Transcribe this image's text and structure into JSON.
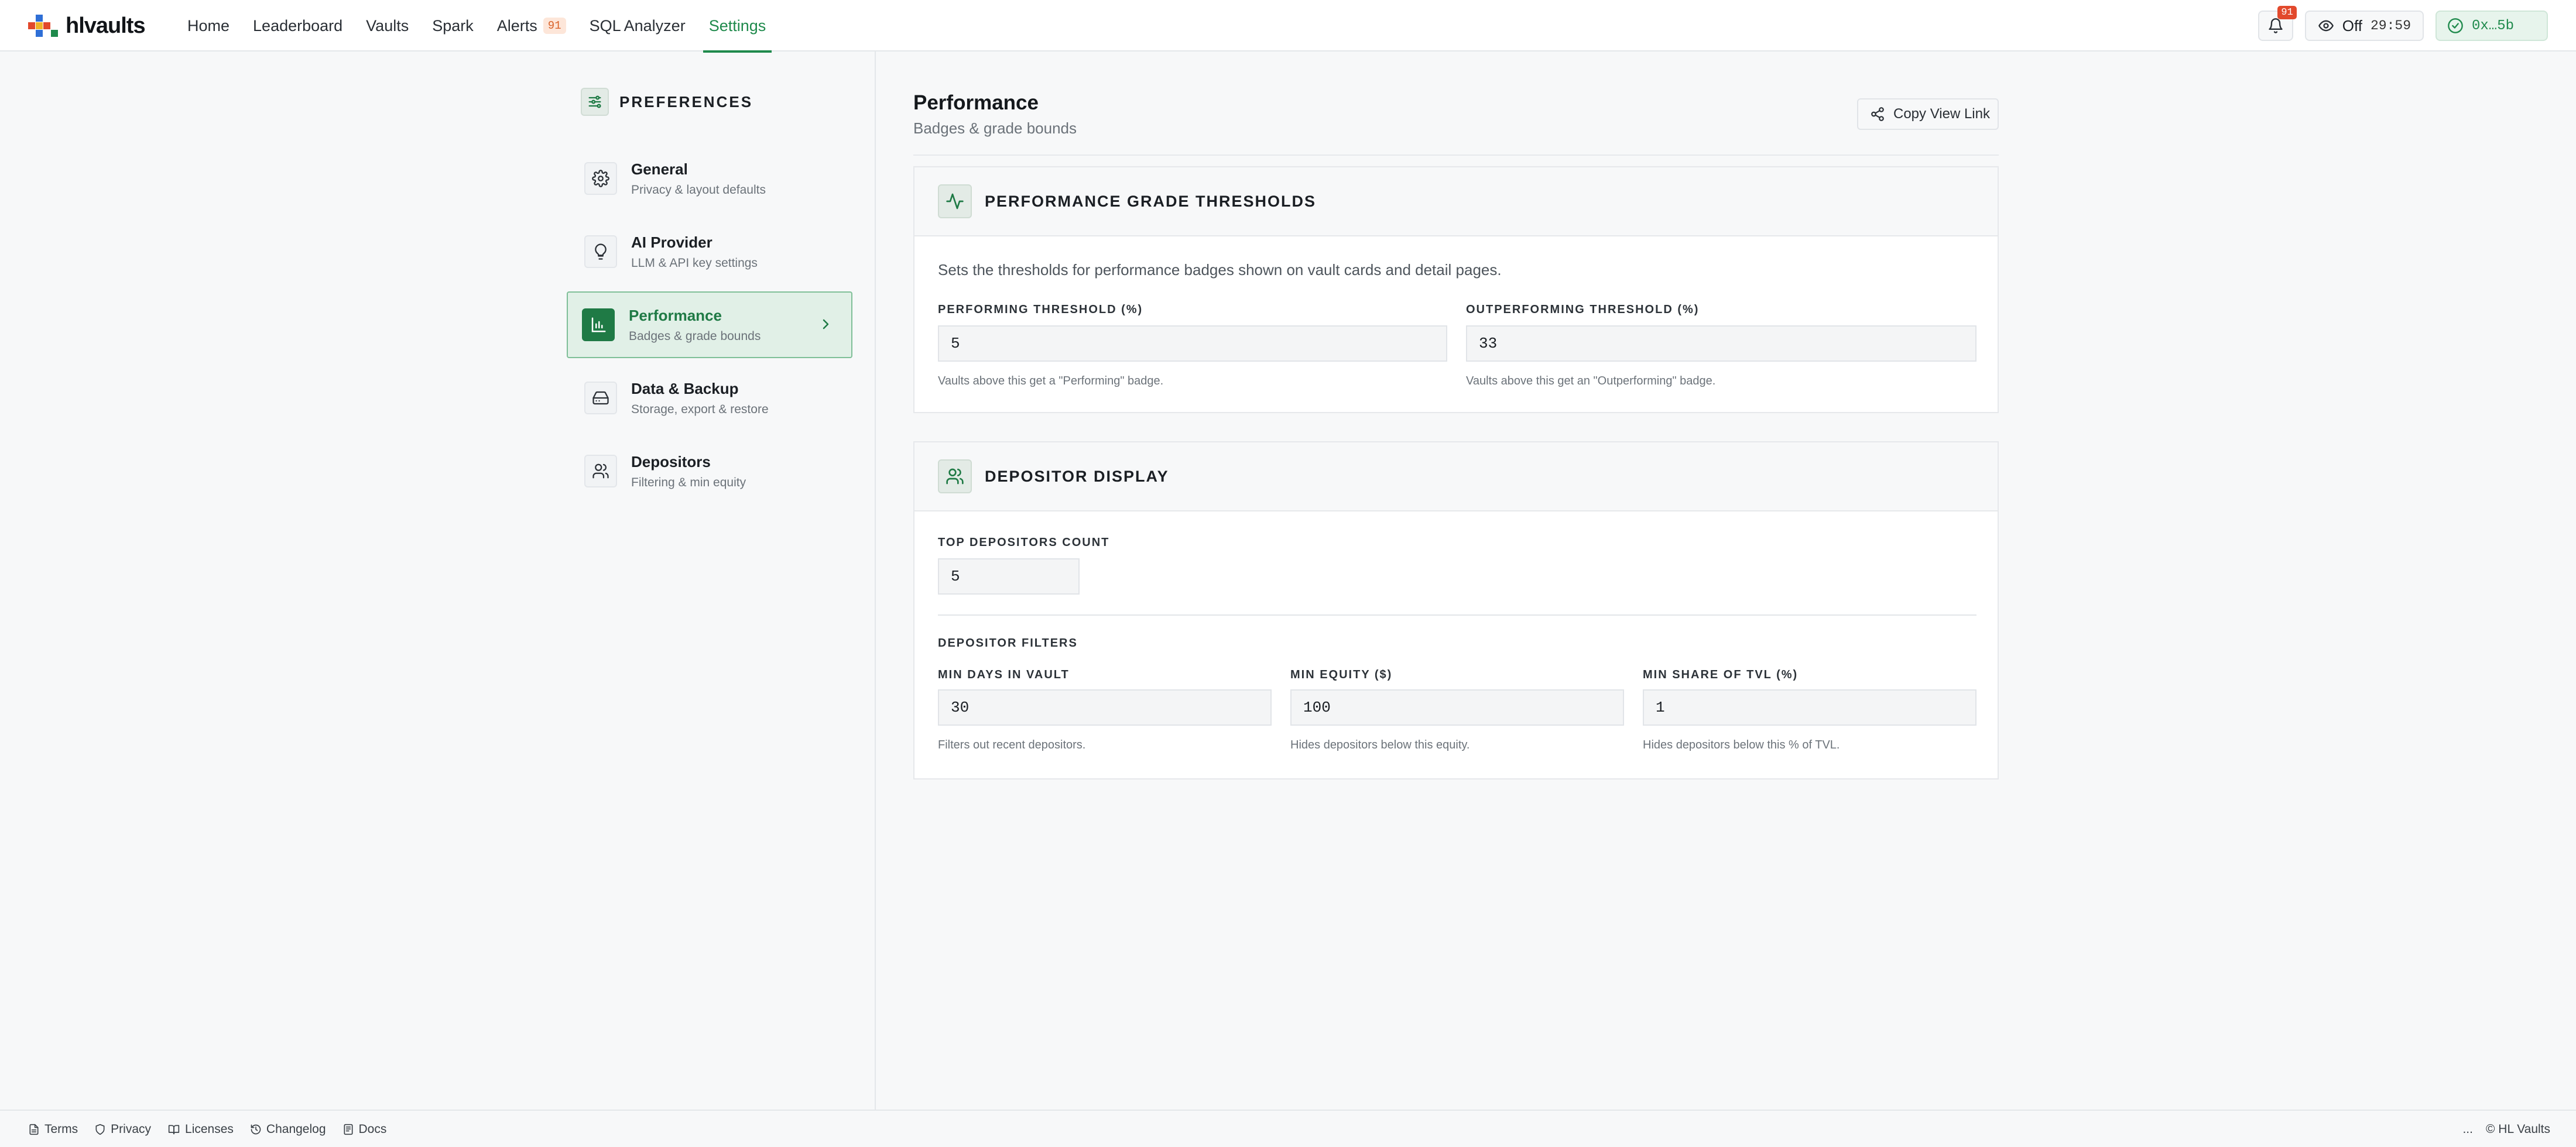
{
  "app": {
    "logo_text": "hlvaults"
  },
  "nav": {
    "items": [
      {
        "label": "Home"
      },
      {
        "label": "Leaderboard"
      },
      {
        "label": "Vaults"
      },
      {
        "label": "Spark"
      },
      {
        "label": "Alerts",
        "badge": "91"
      },
      {
        "label": "SQL Analyzer"
      },
      {
        "label": "Settings",
        "active": true
      }
    ]
  },
  "topbar": {
    "notifications_badge": "91",
    "privacy_label": "Off",
    "privacy_timer": "29:59",
    "wallet_label": "0x…5b"
  },
  "sidebar": {
    "title": "PREFERENCES",
    "items": [
      {
        "label": "General",
        "desc": "Privacy & layout defaults",
        "icon": "gear-icon"
      },
      {
        "label": "AI Provider",
        "desc": "LLM & API key settings",
        "icon": "lightbulb-icon"
      },
      {
        "label": "Performance",
        "desc": "Badges & grade bounds",
        "icon": "bar-chart-icon",
        "active": true
      },
      {
        "label": "Data & Backup",
        "desc": "Storage, export & restore",
        "icon": "hard-drive-icon"
      },
      {
        "label": "Depositors",
        "desc": "Filtering & min equity",
        "icon": "users-icon"
      }
    ]
  },
  "main": {
    "title": "Performance",
    "subtitle": "Badges & grade bounds",
    "copy_link_label": "Copy View Link",
    "grade_card": {
      "title": "PERFORMANCE GRADE THRESHOLDS",
      "description": "Sets the thresholds for performance badges shown on vault cards and detail pages.",
      "performing": {
        "label": "PERFORMING THRESHOLD (%)",
        "value": "5",
        "help": "Vaults above this get a \"Performing\" badge."
      },
      "outperforming": {
        "label": "OUTPERFORMING THRESHOLD (%)",
        "value": "33",
        "help": "Vaults above this get an \"Outperforming\" badge."
      }
    },
    "depositor_card": {
      "title": "DEPOSITOR DISPLAY",
      "top_count": {
        "label": "TOP DEPOSITORS COUNT",
        "value": "5"
      },
      "filters_title": "DEPOSITOR FILTERS",
      "min_days": {
        "label": "MIN DAYS IN VAULT",
        "value": "30",
        "help": "Filters out recent depositors."
      },
      "min_equity": {
        "label": "MIN EQUITY ($)",
        "value": "100",
        "help": "Hides depositors below this equity."
      },
      "min_share": {
        "label": "MIN SHARE OF TVL (%)",
        "value": "1",
        "help": "Hides depositors below this % of TVL."
      }
    }
  },
  "footer": {
    "links": [
      {
        "label": "Terms",
        "icon": "file-icon"
      },
      {
        "label": "Privacy",
        "icon": "shield-icon"
      },
      {
        "label": "Licenses",
        "icon": "book-icon"
      },
      {
        "label": "Changelog",
        "icon": "history-icon"
      },
      {
        "label": "Docs",
        "icon": "doc-icon"
      }
    ],
    "ellipsis": "...",
    "copyright": "© HL Vaults"
  },
  "colors": {
    "accent": "#1f8a4c",
    "alert": "#e2492c"
  }
}
